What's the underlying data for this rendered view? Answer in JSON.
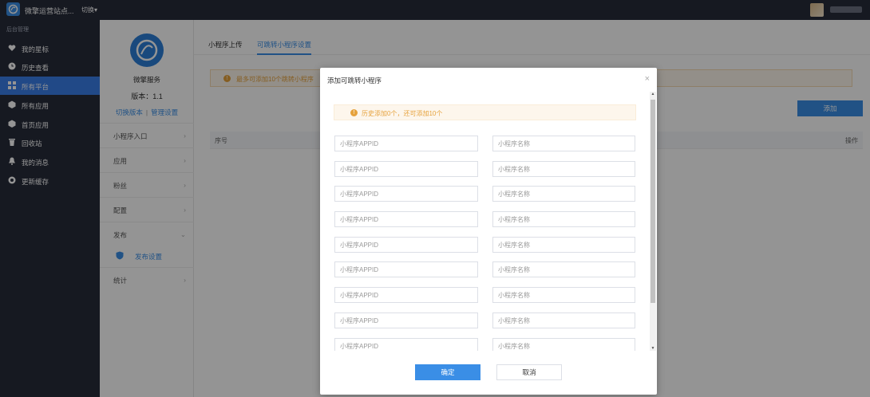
{
  "topbar": {
    "site_name": "微擎运营站点...",
    "switch_label": "切换▾"
  },
  "sidebar": {
    "section_title": "后台管理",
    "items": [
      {
        "label": "我的星标",
        "icon": "heart-icon"
      },
      {
        "label": "历史查看",
        "icon": "clock-icon"
      },
      {
        "label": "所有平台",
        "icon": "grid-icon",
        "active": true
      },
      {
        "label": "所有应用",
        "icon": "cube-icon"
      },
      {
        "label": "首页应用",
        "icon": "cube-icon"
      },
      {
        "label": "回收站",
        "icon": "trash-icon"
      },
      {
        "label": "我的消息",
        "icon": "bell-icon"
      },
      {
        "label": "更新缓存",
        "icon": "refresh-icon"
      }
    ]
  },
  "subnav": {
    "service_name": "微擎服务",
    "version": "版本：1.1",
    "switch_version": "切换版本",
    "separator": "|",
    "manage_settings": "管理设置",
    "menu": [
      {
        "label": "小程序入口"
      },
      {
        "label": "应用"
      },
      {
        "label": "粉丝"
      },
      {
        "label": "配置"
      },
      {
        "label": "发布",
        "expanded": true
      },
      {
        "label": "发布设置",
        "sub": true
      },
      {
        "label": "统计"
      }
    ]
  },
  "main": {
    "tabs": [
      {
        "label": "小程序上传"
      },
      {
        "label": "可跳转小程序设置",
        "active": true
      }
    ],
    "notice": "最多可添加10个跳转小程序",
    "add_button": "添加",
    "table_headers": [
      "序号",
      "操作"
    ]
  },
  "modal": {
    "title": "添加可跳转小程序",
    "close": "×",
    "tip": "历史添加0个，还可添加10个",
    "appid_placeholder": "小程序APPID",
    "name_placeholder": "小程序名称",
    "confirm": "确定",
    "cancel": "取消"
  },
  "colors": {
    "sidebar_bg": "#262b3a",
    "accent": "#3a8ee6",
    "warning": "#e6a23c"
  }
}
